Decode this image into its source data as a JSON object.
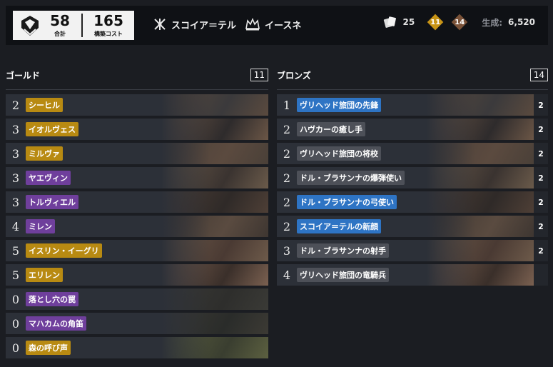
{
  "header": {
    "total_value": "58",
    "total_label": "合計",
    "cost_value": "165",
    "cost_label": "構築コスト",
    "faction_name": "スコイア＝テル",
    "leader_name": "イースネ",
    "cards_count": "25",
    "gold_count": "11",
    "bronze_count": "14",
    "craft_label": "生成:",
    "craft_value": "6,520"
  },
  "gold": {
    "title": "ゴールド",
    "count": "11",
    "cards": [
      {
        "count": "2",
        "name": "シーヒル",
        "color": "gold"
      },
      {
        "count": "3",
        "name": "イオルヴェス",
        "color": "gold"
      },
      {
        "count": "3",
        "name": "ミルヴァ",
        "color": "gold"
      },
      {
        "count": "3",
        "name": "ヤエヴィン",
        "color": "purple"
      },
      {
        "count": "3",
        "name": "トルヴィエル",
        "color": "purple"
      },
      {
        "count": "4",
        "name": "ミレン",
        "color": "purple"
      },
      {
        "count": "5",
        "name": "イスリン・イーグリ",
        "color": "gold"
      },
      {
        "count": "5",
        "name": "エリレン",
        "color": "gold"
      },
      {
        "count": "0",
        "name": "落とし穴の罠",
        "color": "purple"
      },
      {
        "count": "0",
        "name": "マハカムの角笛",
        "color": "purple"
      },
      {
        "count": "0",
        "name": "森の呼び声",
        "color": "gold"
      }
    ]
  },
  "bronze": {
    "title": "ブロンズ",
    "count": "14",
    "cards": [
      {
        "count": "1",
        "name": "ヴリヘッド旅団の先鋒",
        "color": "blue",
        "copies": "2"
      },
      {
        "count": "2",
        "name": "ハヴカーの癒し手",
        "color": "gray",
        "copies": "2"
      },
      {
        "count": "2",
        "name": "ヴリヘッド旅団の将校",
        "color": "gray",
        "copies": "2"
      },
      {
        "count": "2",
        "name": "ドル・ブラサンナの爆弾使い",
        "color": "gray",
        "copies": "2"
      },
      {
        "count": "2",
        "name": "ドル・ブラサンナの弓使い",
        "color": "blue",
        "copies": "2"
      },
      {
        "count": "2",
        "name": "スコイア＝テルの新顔",
        "color": "blue",
        "copies": "2"
      },
      {
        "count": "3",
        "name": "ドル・ブラサンナの射手",
        "color": "gray",
        "copies": "2"
      },
      {
        "count": "4",
        "name": "ヴリヘッド旅団の竜騎兵",
        "color": "gray",
        "copies": ""
      }
    ]
  },
  "colors": {
    "gold_tag": "#b88a12",
    "epic_tag": "#6f3f9c",
    "rare_tag": "#2e74c4",
    "common_tag": "#4d5058",
    "row_bg": "#2c3038",
    "page_bg": "#1b1d22"
  }
}
